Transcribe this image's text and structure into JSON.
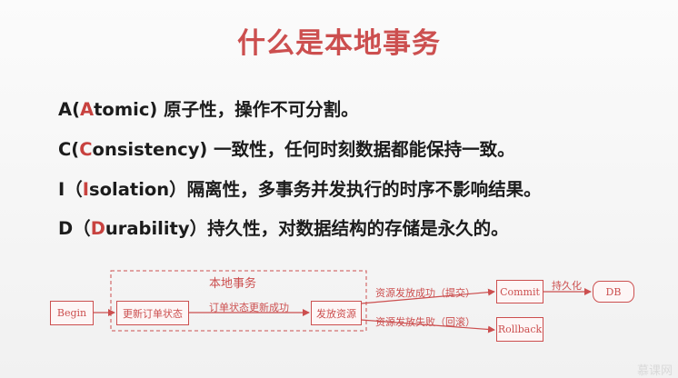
{
  "title": "什么是本地事务",
  "lines": [
    {
      "pre": "A(",
      "key": "A",
      "rest": "tomic) 原子性，操作不可分割。"
    },
    {
      "pre": "C(",
      "key": "C",
      "rest": "onsistency) 一致性，任何时刻数据都能保持一致。"
    },
    {
      "pre": "I（",
      "key": "I",
      "rest": "solation）隔离性，多事务并发执行的时序不影响结果。"
    },
    {
      "pre": "D（",
      "key": "D",
      "rest": "urability）持久性，对数据结构的存储是永久的。"
    }
  ],
  "diagram": {
    "group_label": "本地事务",
    "nodes": {
      "begin": "Begin",
      "update": "更新订单状态",
      "release": "发放资源",
      "commit": "Commit",
      "rollback": "Rollback",
      "db": "DB"
    },
    "edges": {
      "update_success": "订单状态更新成功",
      "release_success": "资源发放成功（提交）",
      "release_fail": "资源发放失败（回滚）",
      "persist": "持久化"
    }
  },
  "watermark": "慕课网",
  "colors": {
    "accent": "#cc4f4f",
    "text": "#1c1c1c"
  }
}
